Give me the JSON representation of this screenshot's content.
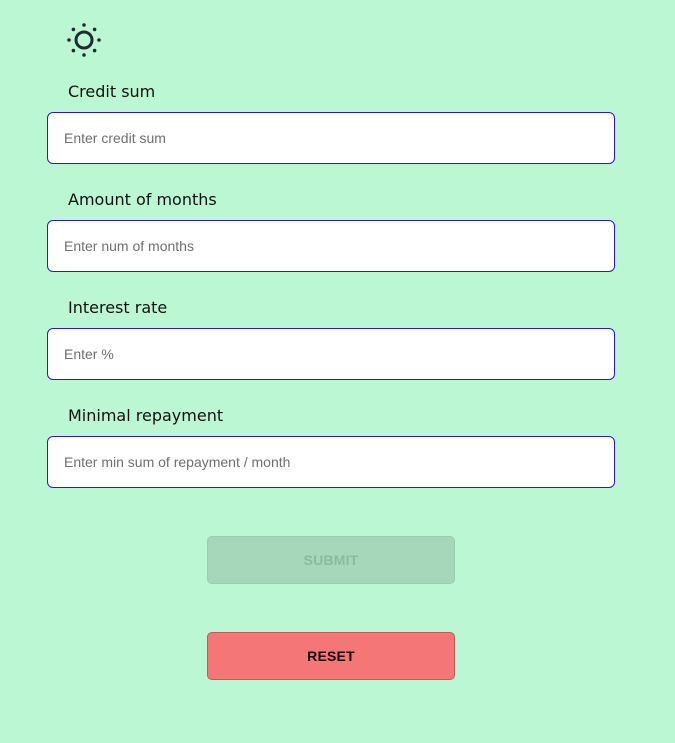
{
  "theme_toggle": {
    "icon": "sun-icon"
  },
  "form": {
    "credit_sum": {
      "label": "Credit sum",
      "placeholder": "Enter credit sum",
      "value": ""
    },
    "months": {
      "label": "Amount of months",
      "placeholder": "Enter num of months",
      "value": ""
    },
    "interest_rate": {
      "label": "Interest rate",
      "placeholder": "Enter %",
      "value": ""
    },
    "min_repayment": {
      "label": "Minimal repayment",
      "placeholder": "Enter min sum of repayment / month",
      "value": ""
    }
  },
  "buttons": {
    "submit_label": "SUBMIT",
    "submit_disabled": true,
    "reset_label": "RESET"
  },
  "colors": {
    "background": "#bcf7d3",
    "input_border": "#2d16d8",
    "submit_bg": "#a6d7bb",
    "reset_bg": "#f47676"
  }
}
